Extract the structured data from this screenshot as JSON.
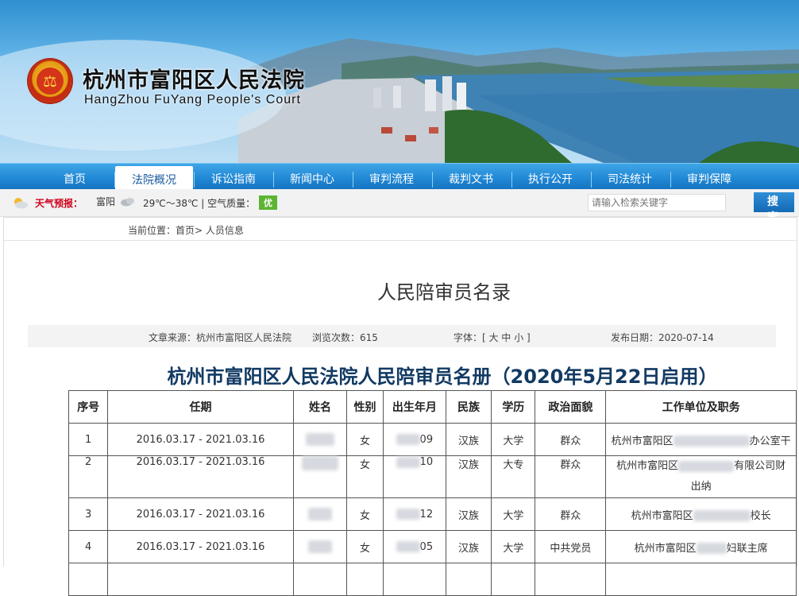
{
  "header": {
    "court_name_cn": "杭州市富阳区人民法院",
    "court_name_en": "HangZhou FuYang People's Court",
    "logo_icon": "court-emblem-icon"
  },
  "nav": {
    "items": [
      {
        "label": "首页",
        "active": false
      },
      {
        "label": "法院概况",
        "active": true
      },
      {
        "label": "诉讼指南",
        "active": false
      },
      {
        "label": "新闻中心",
        "active": false
      },
      {
        "label": "审判流程",
        "active": false
      },
      {
        "label": "裁判文书",
        "active": false
      },
      {
        "label": "执行公开",
        "active": false
      },
      {
        "label": "司法统计",
        "active": false
      },
      {
        "label": "审判保障",
        "active": false
      }
    ]
  },
  "weather": {
    "label": "天气预报：",
    "city": "富阳",
    "temp_aqi": "29℃～38℃ | 空气质量：",
    "aqi_value": "优",
    "aqi_color": "#5cb531"
  },
  "search": {
    "placeholder": "请输入检索关键字",
    "button_label": "搜 索"
  },
  "breadcrumb": "当前位置：首页> 人员信息",
  "article": {
    "title": "人民陪审员名录",
    "source": "文章来源：杭州市富阳区人民法院",
    "views": "浏览次数：615",
    "font_size": "字体：[ 大 中 小 ]",
    "publish_date": "发布日期：2020-07-14",
    "doc_heading": "杭州市富阳区人民法院人民陪审员名册（2020年5月22日启用）"
  },
  "table": {
    "headers": [
      "序号",
      "任期",
      "姓名",
      "性别",
      "出生年月",
      "民族",
      "学历",
      "政治面貌",
      "工作单位及职务"
    ],
    "rows": [
      {
        "no": "1",
        "term": "2016.03.17 - 2021.03.16",
        "gender": "女",
        "birth_tail": "09",
        "ethnicity": "汉族",
        "education": "大学",
        "political": "群众",
        "work_head": "杭州市富阳区",
        "work_tail": "办公室干",
        "work_extra": ""
      },
      {
        "no": "2",
        "term": "2016.03.17 - 2021.03.16",
        "gender": "女",
        "birth_tail": "10",
        "ethnicity": "汉族",
        "education": "大专",
        "political": "群众",
        "work_head": "杭州市富阳区",
        "work_tail": "有限公司财",
        "work_extra": "出纳"
      },
      {
        "no": "3",
        "term": "2016.03.17 - 2021.03.16",
        "gender": "女",
        "birth_tail": "12",
        "ethnicity": "汉族",
        "education": "大学",
        "political": "群众",
        "work_head": "杭州市富阳区",
        "work_tail": "校长",
        "work_extra": ""
      },
      {
        "no": "4",
        "term": "2016.03.17 - 2021.03.16",
        "gender": "女",
        "birth_tail": "05",
        "ethnicity": "汉族",
        "education": "大学",
        "political": "中共党员",
        "work_head": "杭州市富阳区",
        "work_tail": "妇联主席",
        "work_extra": ""
      }
    ]
  },
  "colors": {
    "nav_blue": "#1f86d4",
    "heading_navy": "#123a63",
    "weather_label_red": "#d0001a"
  }
}
